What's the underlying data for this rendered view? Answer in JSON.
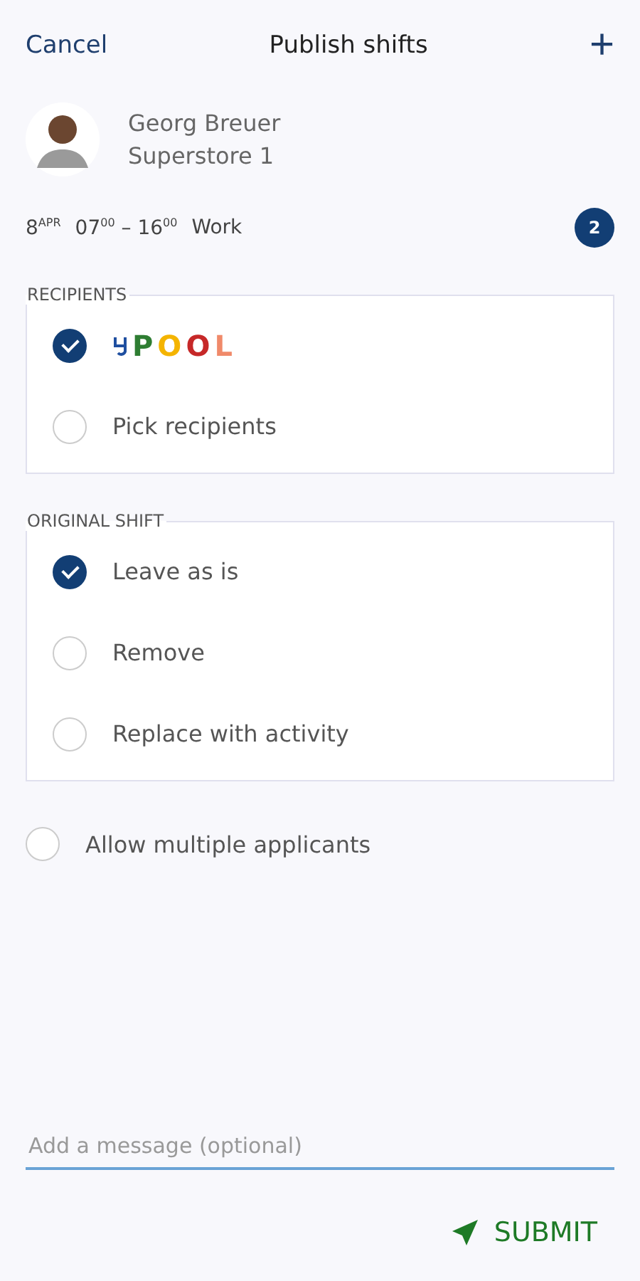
{
  "header": {
    "cancel": "Cancel",
    "title": "Publish shifts",
    "add": "+"
  },
  "employee": {
    "name": "Georg Breuer",
    "store": "Superstore 1"
  },
  "shift": {
    "date": "8$^{APR}$",
    "time": "07$^{00}$ – 16$^{00}$",
    "type": "Work",
    "count": "2"
  },
  "recipients": {
    "legend": "RECIPIENTS",
    "options": [
      {
        "kind": "logo",
        "selected": true,
        "letters": [
          {
            "text": "P",
            "color": "#2e7d32"
          },
          {
            "text": "O",
            "color": "#f4b400"
          },
          {
            "text": "O",
            "color": "#c62828"
          },
          {
            "text": "L",
            "color": "#f08a6a"
          }
        ]
      },
      {
        "kind": "text",
        "selected": false,
        "label": "Pick recipients"
      }
    ]
  },
  "original_shift": {
    "legend": "ORIGINAL SHIFT",
    "options": [
      {
        "label": "Leave as is",
        "selected": true
      },
      {
        "label": "Remove",
        "selected": false
      },
      {
        "label": "Replace with activity",
        "selected": false
      }
    ]
  },
  "allow_multiple": {
    "label": "Allow multiple applicants",
    "checked": false
  },
  "message": {
    "placeholder": "Add a message (optional)"
  },
  "submit": "SUBMIT"
}
